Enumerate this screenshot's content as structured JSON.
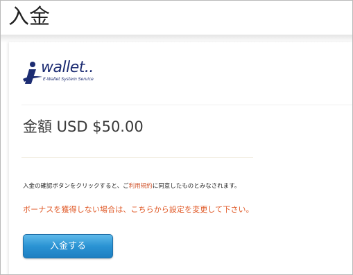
{
  "header": {
    "title": "入金"
  },
  "logo": {
    "wordmark": "wallet..",
    "tagline": "E-Wallet System Service",
    "brand_color": "#1c2c72",
    "icon": "i-wallet-logo-icon"
  },
  "amount": {
    "text": "金額 USD $50.00"
  },
  "notice": {
    "prefix": "入金の確認ボタンをクリックすると、ご",
    "link": "利用規約",
    "suffix": "に同意したものとみなされます。"
  },
  "bonus": {
    "text": "ボーナスを獲得しない場合は、こちらから設定を変更して下さい。",
    "color": "#e05a28"
  },
  "actions": {
    "deposit_label": "入金する",
    "button_color": "#2a93d3"
  }
}
